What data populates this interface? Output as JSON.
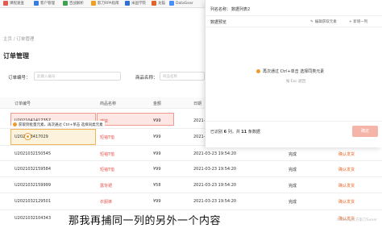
{
  "bookmarks": [
    "课程速查",
    "客户管理",
    "百战解析",
    "影刀RPA指南",
    "米国学院",
    "龙猫",
    "DataGear"
  ],
  "breadcrumb": "主页 / 订单管理",
  "page_title": "订单管理",
  "filters": {
    "order_no_label": "订单编号：",
    "order_no_placeholder": "此输入编号",
    "product_label": "商品名称：",
    "product_placeholder": "商品名称"
  },
  "table": {
    "headers": [
      "订单编号",
      "商品名称",
      "金额",
      "日期"
    ],
    "rows": [
      {
        "id": "U2021041417357",
        "product": "捕获",
        "amount": "¥99",
        "date": "2021-",
        "status": "",
        "action": ""
      },
      {
        "id": "U202103417029",
        "product": "短袖T恤",
        "amount": "¥99",
        "date": "2021-",
        "status": "",
        "action": ""
      },
      {
        "id": "U2021032150545",
        "product": "短袖T恤",
        "amount": "¥99",
        "date": "2021-03-23 19:54:20",
        "status": "完成",
        "action": "确认发货"
      },
      {
        "id": "U2021032159584",
        "product": "短袖T恤",
        "amount": "¥99",
        "date": "2021-03-23 19:54:20",
        "status": "完成",
        "action": "确认发货"
      },
      {
        "id": "U2021032159999",
        "product": "露背裙",
        "amount": "¥58",
        "date": "2021-03-23 19:54:20",
        "status": "完成",
        "action": "确认发货"
      },
      {
        "id": "U2021032129501",
        "product": "衣服裤",
        "amount": "¥99",
        "date": "2021-03-23 19:54:20",
        "status": "完成",
        "action": "确认发货"
      },
      {
        "id": "U2021032104343",
        "product": "",
        "amount": "",
        "date": "",
        "status": "",
        "action": "确认发货"
      }
    ]
  },
  "tooltip": "获取到批量元素，再次通过 Ctrl+单击 选择同类元素",
  "panel": {
    "list_name_label": "列名名称：",
    "list_name_value": "数据列表2",
    "preview_label": "数据预览",
    "edit_button": "编辑获取元素",
    "add_column_button": "+ 新增一列",
    "hint": "再次通过 Ctrl+单击 选择同类元素",
    "esc": "按 Esc 退回",
    "count_prefix": "已识别",
    "count_rows": "6",
    "count_mid": "列，共",
    "count_items": "11",
    "count_suffix": "条数据",
    "ok_button": "确定"
  },
  "subtitle": "那我再捕同一列的另外一个内容",
  "watermark": "CSDN @大方影刀Suner"
}
